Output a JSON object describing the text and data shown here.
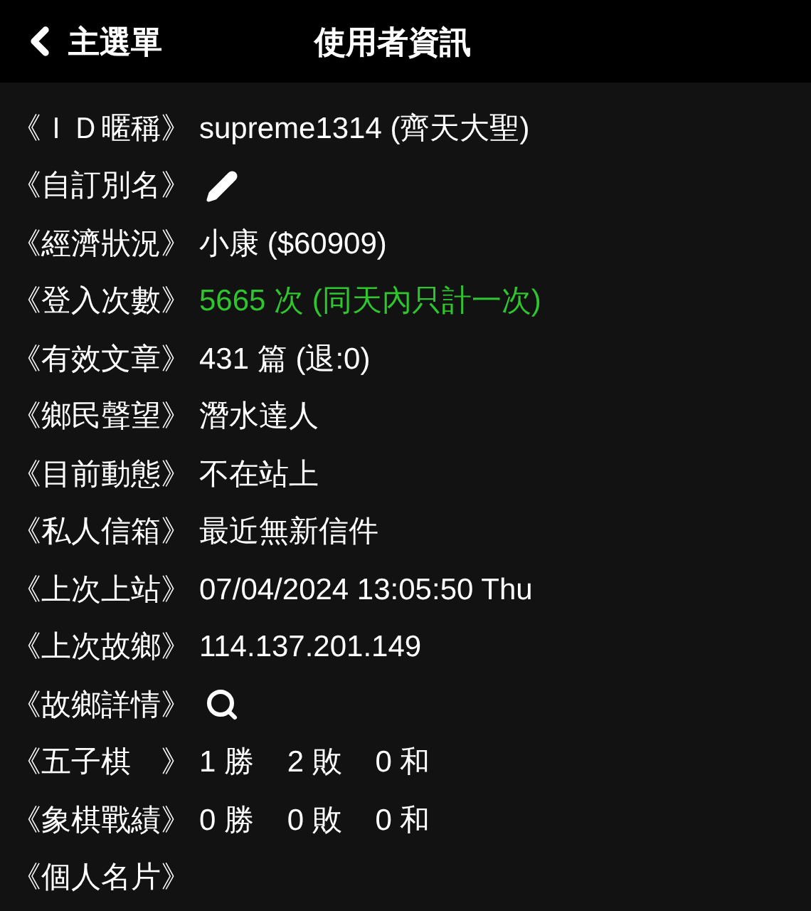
{
  "header": {
    "back_label": "主選單",
    "title": "使用者資訊"
  },
  "rows": [
    {
      "label": "《ＩＤ暱稱》",
      "kind": "text",
      "value": "supreme1314 (齊天大聖)"
    },
    {
      "label": "《自訂別名》",
      "kind": "edit"
    },
    {
      "label": "《經濟狀況》",
      "kind": "text",
      "value": "小康 ($60909)"
    },
    {
      "label": "《登入次數》",
      "kind": "highlight",
      "value": "5665 次 (同天內只計一次)"
    },
    {
      "label": "《有效文章》",
      "kind": "text",
      "value": "431 篇 (退:0)"
    },
    {
      "label": "《鄉民聲望》",
      "kind": "text",
      "value": "潛水達人"
    },
    {
      "label": "《目前動態》",
      "kind": "text",
      "value": "不在站上"
    },
    {
      "label": "《私人信箱》",
      "kind": "text",
      "value": "最近無新信件"
    },
    {
      "label": "《上次上站》",
      "kind": "text",
      "value": "07/04/2024 13:05:50 Thu"
    },
    {
      "label": "《上次故鄉》",
      "kind": "text",
      "value": "114.137.201.149"
    },
    {
      "label": "《故鄉詳情》",
      "kind": "search"
    },
    {
      "label": "《五子棋　》",
      "kind": "text",
      "value": "1 勝    2 敗    0 和"
    },
    {
      "label": "《象棋戰績》",
      "kind": "text",
      "value": "0 勝    0 敗    0 和"
    },
    {
      "label": "《個人名片》",
      "kind": "none"
    }
  ]
}
